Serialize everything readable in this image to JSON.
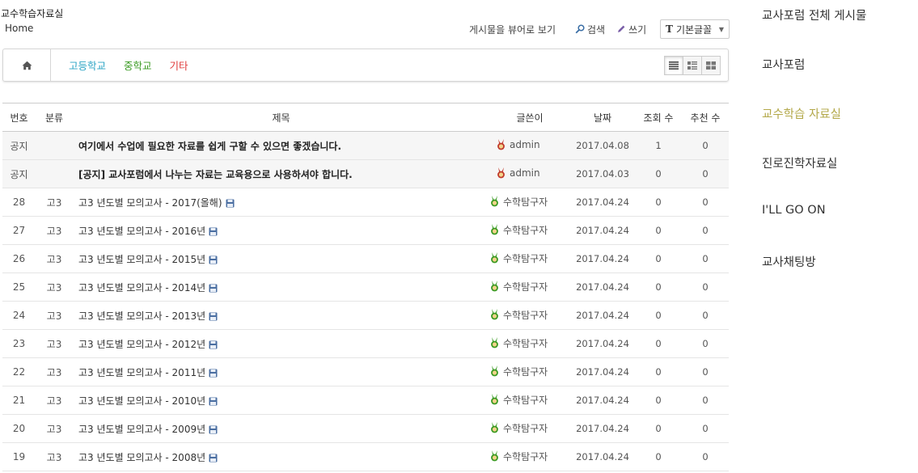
{
  "board": {
    "title": "교수학습자료실",
    "breadcrumb": "Home"
  },
  "toolbar": {
    "view_label": "게시물을 뷰어로 보기",
    "search_label": "검색",
    "write_label": "쓰기",
    "font_label": "기본글꼴"
  },
  "categories": [
    {
      "label": "고등학교",
      "color": "#2aa3c4"
    },
    {
      "label": "중학교",
      "color": "#3a9a22"
    },
    {
      "label": "기타",
      "color": "#e03b3b"
    }
  ],
  "table": {
    "headers": {
      "no": "번호",
      "cat": "분류",
      "title": "제목",
      "author": "글쓴이",
      "date": "날짜",
      "views": "조회 수",
      "likes": "추천 수"
    },
    "notices": [
      {
        "no": "공지",
        "title": "여기에서 수업에 필요한 자료를 쉽게 구할 수 있으면 좋겠습니다.",
        "author": "admin",
        "date": "2017.04.08",
        "views": "1",
        "likes": "0"
      },
      {
        "no": "공지",
        "title": "[공지] 교사포럼에서 나누는 자료는 교육용으로 사용하셔야 합니다.",
        "author": "admin",
        "date": "2017.04.03",
        "views": "0",
        "likes": "0"
      }
    ],
    "rows": [
      {
        "no": "28",
        "cat": "고3",
        "title": "고3 년도별 모의고사 - 2017(올해)",
        "author": "수학탐구자",
        "date": "2017.04.24",
        "views": "0",
        "likes": "0"
      },
      {
        "no": "27",
        "cat": "고3",
        "title": "고3 년도별 모의고사 - 2016년",
        "author": "수학탐구자",
        "date": "2017.04.24",
        "views": "0",
        "likes": "0"
      },
      {
        "no": "26",
        "cat": "고3",
        "title": "고3 년도별 모의고사 - 2015년",
        "author": "수학탐구자",
        "date": "2017.04.24",
        "views": "0",
        "likes": "0"
      },
      {
        "no": "25",
        "cat": "고3",
        "title": "고3 년도별 모의고사 - 2014년",
        "author": "수학탐구자",
        "date": "2017.04.24",
        "views": "0",
        "likes": "0"
      },
      {
        "no": "24",
        "cat": "고3",
        "title": "고3 년도별 모의고사 - 2013년",
        "author": "수학탐구자",
        "date": "2017.04.24",
        "views": "0",
        "likes": "0"
      },
      {
        "no": "23",
        "cat": "고3",
        "title": "고3 년도별 모의고사 - 2012년",
        "author": "수학탐구자",
        "date": "2017.04.24",
        "views": "0",
        "likes": "0"
      },
      {
        "no": "22",
        "cat": "고3",
        "title": "고3 년도별 모의고사 - 2011년",
        "author": "수학탐구자",
        "date": "2017.04.24",
        "views": "0",
        "likes": "0"
      },
      {
        "no": "21",
        "cat": "고3",
        "title": "고3 년도별 모의고사 - 2010년",
        "author": "수학탐구자",
        "date": "2017.04.24",
        "views": "0",
        "likes": "0"
      },
      {
        "no": "20",
        "cat": "고3",
        "title": "고3 년도별 모의고사 - 2009년",
        "author": "수학탐구자",
        "date": "2017.04.24",
        "views": "0",
        "likes": "0"
      },
      {
        "no": "19",
        "cat": "고3",
        "title": "고3 년도별 모의고사 - 2008년",
        "author": "수학탐구자",
        "date": "2017.04.24",
        "views": "0",
        "likes": "0"
      }
    ]
  },
  "side_nav": [
    {
      "label": "교사포럼 전체 게시물",
      "active": false
    },
    {
      "label": "교사포럼",
      "active": false
    },
    {
      "label": "교수학습 자료실",
      "active": true
    },
    {
      "label": "진로진학자료실",
      "active": false
    },
    {
      "label": "I'LL GO ON",
      "active": false
    },
    {
      "label": "교사채팅방",
      "active": false
    }
  ],
  "colors": {
    "accent": "#b3a849",
    "admin_medal": "#c0392b",
    "member_medal": "#3a9a22"
  }
}
